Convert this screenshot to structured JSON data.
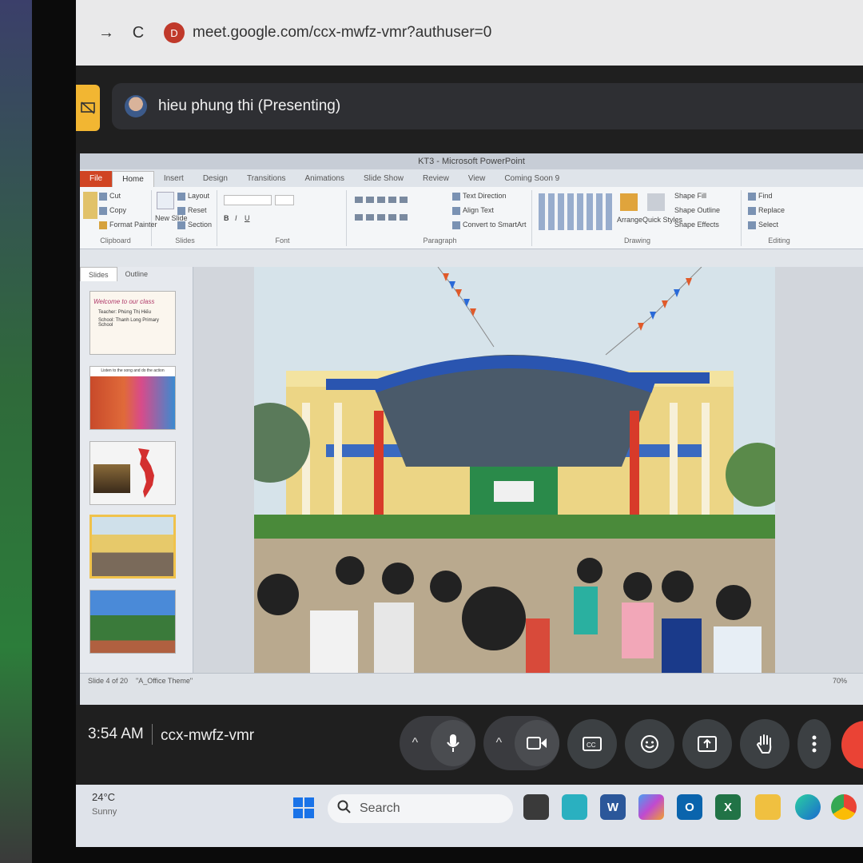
{
  "browser": {
    "back_glyph": "→",
    "reload_glyph": "C",
    "site_icon_glyph": "D",
    "url": "meet.google.com/ccx-mwfz-vmr?authuser=0"
  },
  "meet": {
    "presenter_label": "hieu phung thi (Presenting)",
    "time": "3:54 AM",
    "meeting_code": "ccx-mwfz-vmr",
    "controls": {
      "chevron_glyph": "^",
      "mic_icon": "mic-icon",
      "camera_icon": "camera-icon",
      "captions_icon": "captions-icon",
      "emoji_icon": "emoji-icon",
      "present_icon": "present-icon",
      "hand_icon": "raise-hand-icon",
      "more_icon": "more-vert-icon",
      "end_call_color": "#ea4335"
    }
  },
  "powerpoint": {
    "title": "KT3 - Microsoft PowerPoint",
    "tabs": [
      "File",
      "Home",
      "Insert",
      "Design",
      "Transitions",
      "Animations",
      "Slide Show",
      "Review",
      "View",
      "Coming Soon 9"
    ],
    "groups": {
      "clipboard": {
        "label": "Clipboard",
        "cut": "Cut",
        "copy": "Copy",
        "format_painter": "Format Painter"
      },
      "slides": {
        "label": "Slides",
        "layout": "Layout",
        "reset": "Reset",
        "section": "Section",
        "new_slide": "New Slide"
      },
      "font": {
        "label": "Font"
      },
      "paragraph": {
        "label": "Paragraph",
        "text_direction": "Text Direction",
        "align_text": "Align Text",
        "convert": "Convert to SmartArt"
      },
      "drawing": {
        "label": "Drawing",
        "arrange": "Arrange",
        "quick_styles": "Quick Styles",
        "shape_fill": "Shape Fill",
        "shape_outline": "Shape Outline",
        "shape_effects": "Shape Effects"
      },
      "editing": {
        "label": "Editing",
        "find": "Find",
        "replace": "Replace",
        "select": "Select"
      }
    },
    "panel_tabs": [
      "Slides",
      "Outline"
    ],
    "thumb1": {
      "line1": "Welcome to our class",
      "line2": "Teacher: Phùng Thị Hiếu",
      "line3": "School: Thanh Long Primary School"
    },
    "thumb2_caption": "Listen to the song and do the action",
    "status_text": "Slide 4 of 20",
    "status_theme": "\"A_Office Theme\"",
    "zoom": "70%"
  },
  "taskbar": {
    "temperature": "24°C",
    "weather_desc": "Sunny",
    "search_label": "Search",
    "apps": [
      {
        "name": "word",
        "letter": "W",
        "color": "#2b579a"
      },
      {
        "name": "outlook",
        "letter": "O",
        "color": "#0a64ad"
      },
      {
        "name": "excel",
        "letter": "X",
        "color": "#217346"
      }
    ]
  }
}
